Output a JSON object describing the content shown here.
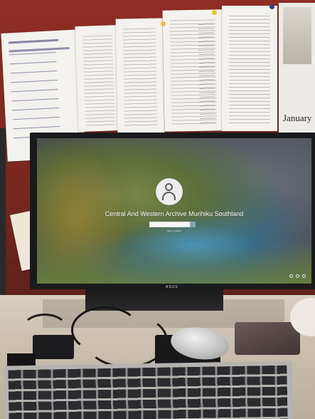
{
  "screen": {
    "account_name": "Central And Western Archive Murihiku Southland",
    "signin_option": "Sign-in options"
  },
  "wall": {
    "calendar_month": "January"
  },
  "monitor": {
    "brand": "ASUS"
  }
}
